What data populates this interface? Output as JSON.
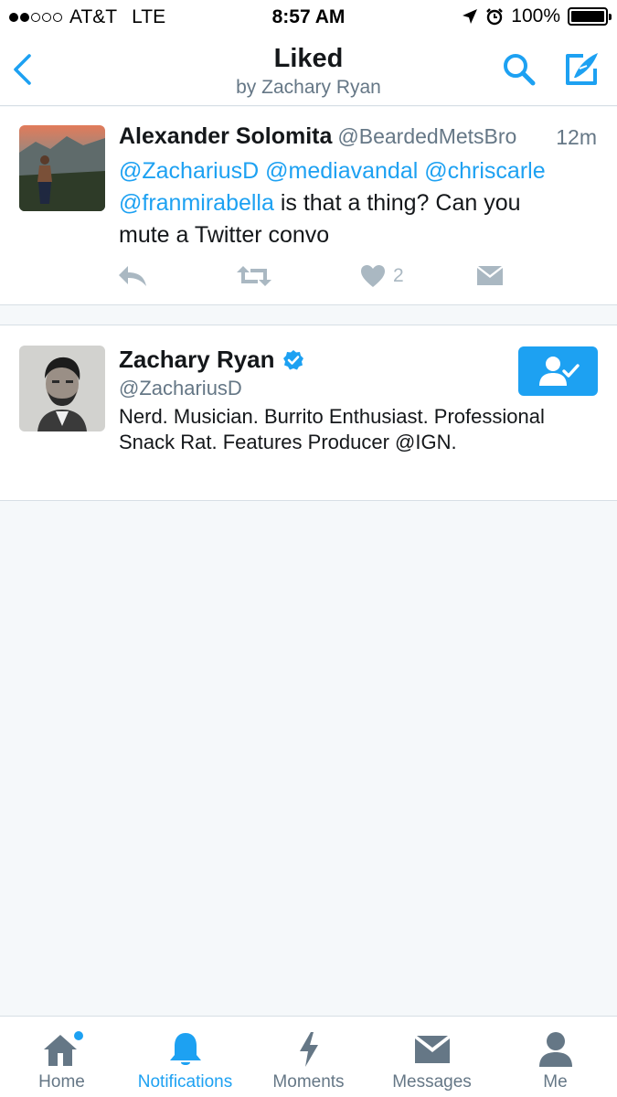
{
  "status_bar": {
    "carrier": "AT&T",
    "network": "LTE",
    "time": "8:57 AM",
    "battery": "100%",
    "signal_bars_filled": 2,
    "signal_bars_total": 5
  },
  "nav": {
    "title": "Liked",
    "subtitle": "by Zachary Ryan",
    "back_icon": "chevron-left-icon",
    "search_icon": "search-icon",
    "compose_icon": "compose-icon"
  },
  "tweet": {
    "name": "Alexander Solomita",
    "handle": "@BeardedMetsBro",
    "time": "12m",
    "mentions_line1": [
      "@ZachariusD",
      "@mediavandal",
      "@chriscarle"
    ],
    "mention_line2": "@franmirabella",
    "text_line2": " is that a thing? Can you",
    "text_line3": "mute a Twitter convo",
    "like_count": "2"
  },
  "profile": {
    "name": "Zachary Ryan",
    "handle": "@ZachariusD",
    "bio": "Nerd. Musician. Burrito Enthusiast. Professional Snack Rat. Features Producer @IGN.",
    "verified": true
  },
  "tabbar": {
    "tabs": [
      {
        "label": "Home",
        "icon": "home-icon",
        "active": false
      },
      {
        "label": "Notifications",
        "icon": "bell-icon",
        "active": true
      },
      {
        "label": "Moments",
        "icon": "lightning-icon",
        "active": false
      },
      {
        "label": "Messages",
        "icon": "envelope-icon",
        "active": false
      },
      {
        "label": "Me",
        "icon": "person-icon",
        "active": false
      }
    ]
  },
  "colors": {
    "accent": "#1da1f2",
    "icon_gray": "#aab8c2",
    "tab_gray": "#657786"
  }
}
